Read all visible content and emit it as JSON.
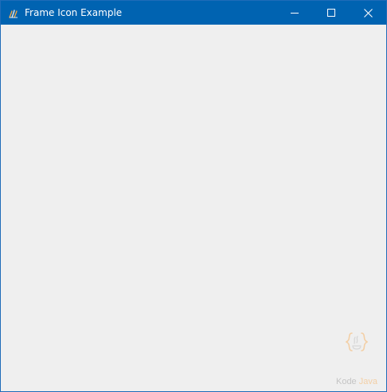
{
  "window": {
    "title": "Frame Icon Example",
    "app_icon": "java-cup-icon",
    "controls": {
      "minimize_icon": "minimize-icon",
      "maximize_icon": "maximize-icon",
      "close_icon": "close-icon"
    }
  },
  "watermark": {
    "logo_icon": "kodejava-logo-icon",
    "text_part1": "Kode",
    "text_part2": "Java"
  },
  "colors": {
    "titlebar": "#0063b1",
    "client_background": "#efefef",
    "title_text": "#ffffff",
    "watermark_gray": "#c4c4c4",
    "watermark_orange": "#f3cfa6"
  }
}
